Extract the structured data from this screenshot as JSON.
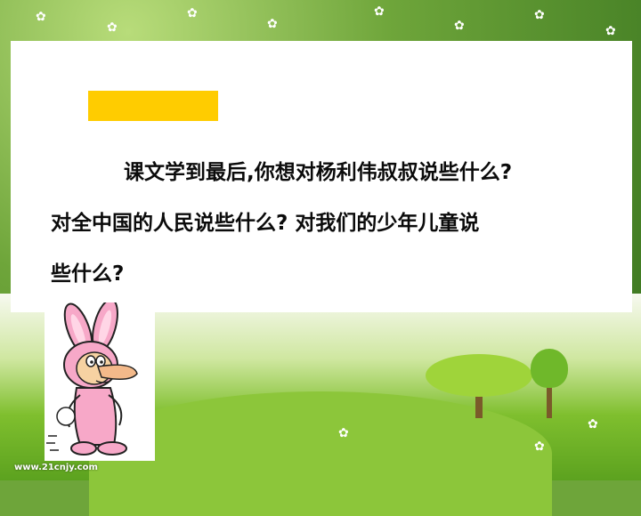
{
  "slide": {
    "paragraph_line1": "课文学到最后,你想对杨利伟叔叔说些什么?",
    "paragraph_line2": "对全中国的人民说些什么? 对我们的少年儿童说",
    "paragraph_line3": "些什么?",
    "watermark": "www.21cnjy.com"
  },
  "colors": {
    "highlight_bar": "#ffcc00",
    "panel": "#ffffff",
    "grass": "#7fbf2e"
  },
  "icons": {
    "cartoon": "rabbit-costume-character-icon"
  }
}
